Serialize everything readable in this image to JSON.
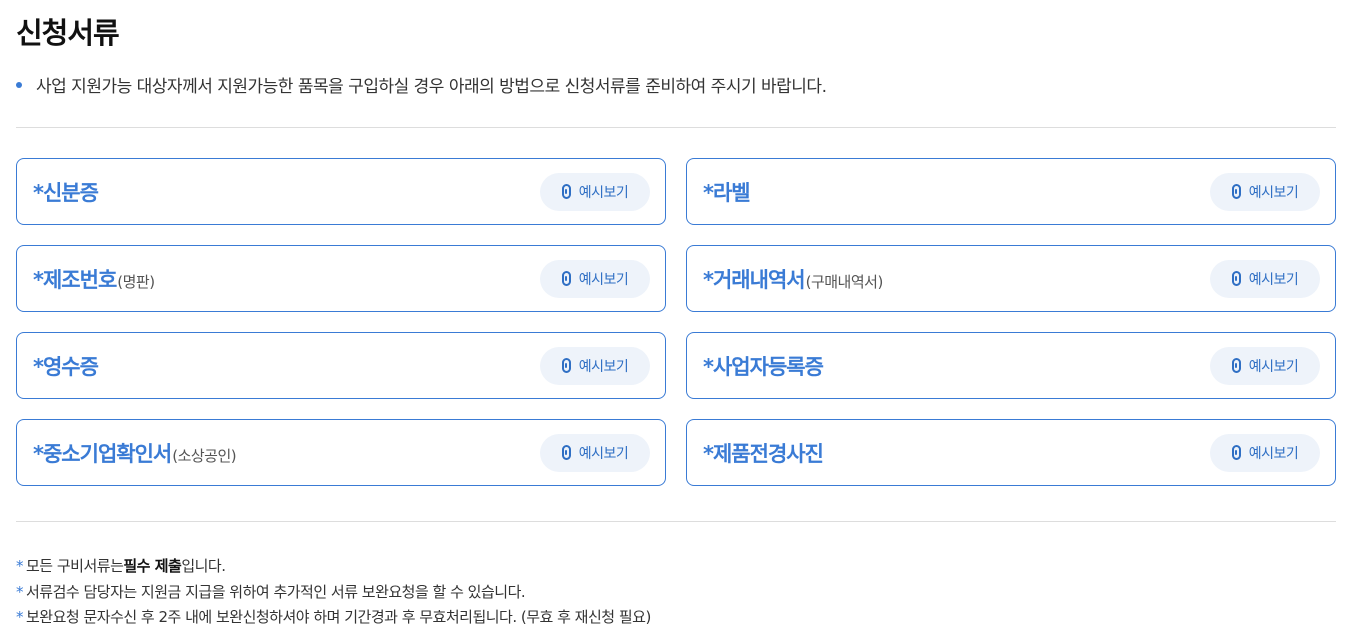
{
  "page": {
    "title": "신청서류",
    "intro": "사업 지원가능 대상자께서 지원가능한 품목을 구입하실 경우 아래의 방법으로 신청서류를 준비하여 주시기 바랍니다."
  },
  "documents": [
    {
      "prefix": "*",
      "name": "신분증",
      "sub": "",
      "button": "예시보기"
    },
    {
      "prefix": "*",
      "name": "라벨",
      "sub": "",
      "button": "예시보기"
    },
    {
      "prefix": "*",
      "name": "제조번호",
      "sub": "(명판)",
      "button": "예시보기"
    },
    {
      "prefix": "*",
      "name": "거래내역서",
      "sub": "(구매내역서)",
      "button": "예시보기"
    },
    {
      "prefix": "*",
      "name": "영수증",
      "sub": "",
      "button": "예시보기"
    },
    {
      "prefix": "*",
      "name": "사업자등록증",
      "sub": "",
      "button": "예시보기"
    },
    {
      "prefix": "*",
      "name": "중소기업확인서",
      "sub": "(소상공인)",
      "button": "예시보기"
    },
    {
      "prefix": "*",
      "name": "제품전경사진",
      "sub": "",
      "button": "예시보기"
    }
  ],
  "notes": [
    {
      "star": "*",
      "before": "모든 구비서류는 ",
      "bold": "필수 제출",
      "after": "입니다."
    },
    {
      "star": "*",
      "before": "서류검수 담당자는 지원금 지급을 위하여 추가적인 서류 보완요청을 할 수 있습니다.",
      "bold": "",
      "after": ""
    },
    {
      "star": "*",
      "before": "보완요청 문자수신 후 2주 내에 보완신청하셔야 하며 기간경과 후 무효처리됩니다. (무효 후 재신청 필요)",
      "bold": "",
      "after": ""
    }
  ],
  "colors": {
    "accent": "#3a7bd5",
    "button_bg": "#eef3fa"
  },
  "icons": {
    "example_button": "link-icon"
  }
}
